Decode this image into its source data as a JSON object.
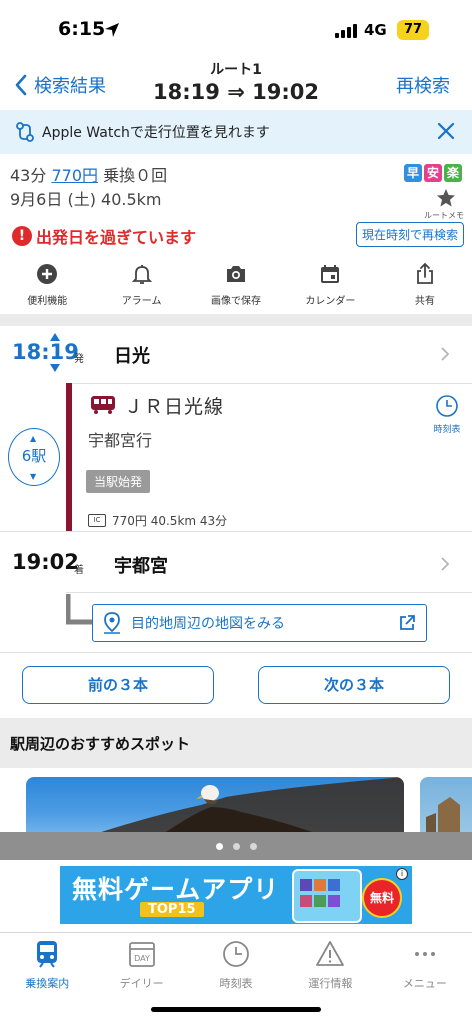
{
  "status_bar": {
    "time": "6:15",
    "network": "4G",
    "battery": "77"
  },
  "nav": {
    "back_label": "検索結果",
    "route_label": "ルート1",
    "time_range": "18:19 ⇒ 19:02",
    "research_label": "再検索"
  },
  "banner": {
    "text": "Apple Watchで走行位置を見れます"
  },
  "summary": {
    "duration": "43分",
    "fare": "770円",
    "transfers": "乗換０回",
    "date_distance": "9月6日 (土) 40.5km",
    "badges": [
      {
        "label": "早",
        "color": "#2f8fe0"
      },
      {
        "label": "安",
        "color": "#e6408a"
      },
      {
        "label": "楽",
        "color": "#49b24a"
      }
    ],
    "memo_label": "ルートメモ",
    "warning": "出発日を過ぎています",
    "now_button": "現在時刻で再検索"
  },
  "toolbar": [
    {
      "icon": "plus-circle-icon",
      "label": "便利機能"
    },
    {
      "icon": "bell-icon",
      "label": "アラーム"
    },
    {
      "icon": "camera-icon",
      "label": "画像で保存"
    },
    {
      "icon": "calendar-icon",
      "label": "カレンダー"
    },
    {
      "icon": "share-icon",
      "label": "共有"
    }
  ],
  "route": {
    "departure": {
      "time": "18:19",
      "suffix": "発",
      "station": "日光"
    },
    "line": {
      "name": "ＪＲ日光線",
      "destination": "宇都宮行",
      "tag": "当駅始発",
      "details": "770円 40.5km 43分",
      "ic_label": "IC",
      "stations": "6駅",
      "timetable_label": "時刻表",
      "color": "#8a1530"
    },
    "arrival": {
      "time": "19:02",
      "suffix": "着",
      "station": "宇都宮"
    },
    "map_button": "目的地周辺の地図をみる"
  },
  "paging": {
    "prev": "前の３本",
    "next": "次の３本"
  },
  "spots": {
    "heading": "駅周辺のおすすめスポット"
  },
  "ad": {
    "headline": "無料ゲームアプリ",
    "sub": "TOP15",
    "badge": "無料",
    "info": "i"
  },
  "tabbar": [
    {
      "label": "乗換案内",
      "icon": "train-icon",
      "active": true
    },
    {
      "label": "デイリー",
      "icon": "day-calendar-icon",
      "active": false,
      "icon_text": "DAY"
    },
    {
      "label": "時刻表",
      "icon": "clock-icon",
      "active": false
    },
    {
      "label": "運行情報",
      "icon": "warning-icon",
      "active": false
    },
    {
      "label": "メニュー",
      "icon": "more-icon",
      "active": false
    }
  ],
  "colors": {
    "accent": "#1a73c8",
    "warning": "#e02a2a",
    "line": "#8a1530"
  }
}
